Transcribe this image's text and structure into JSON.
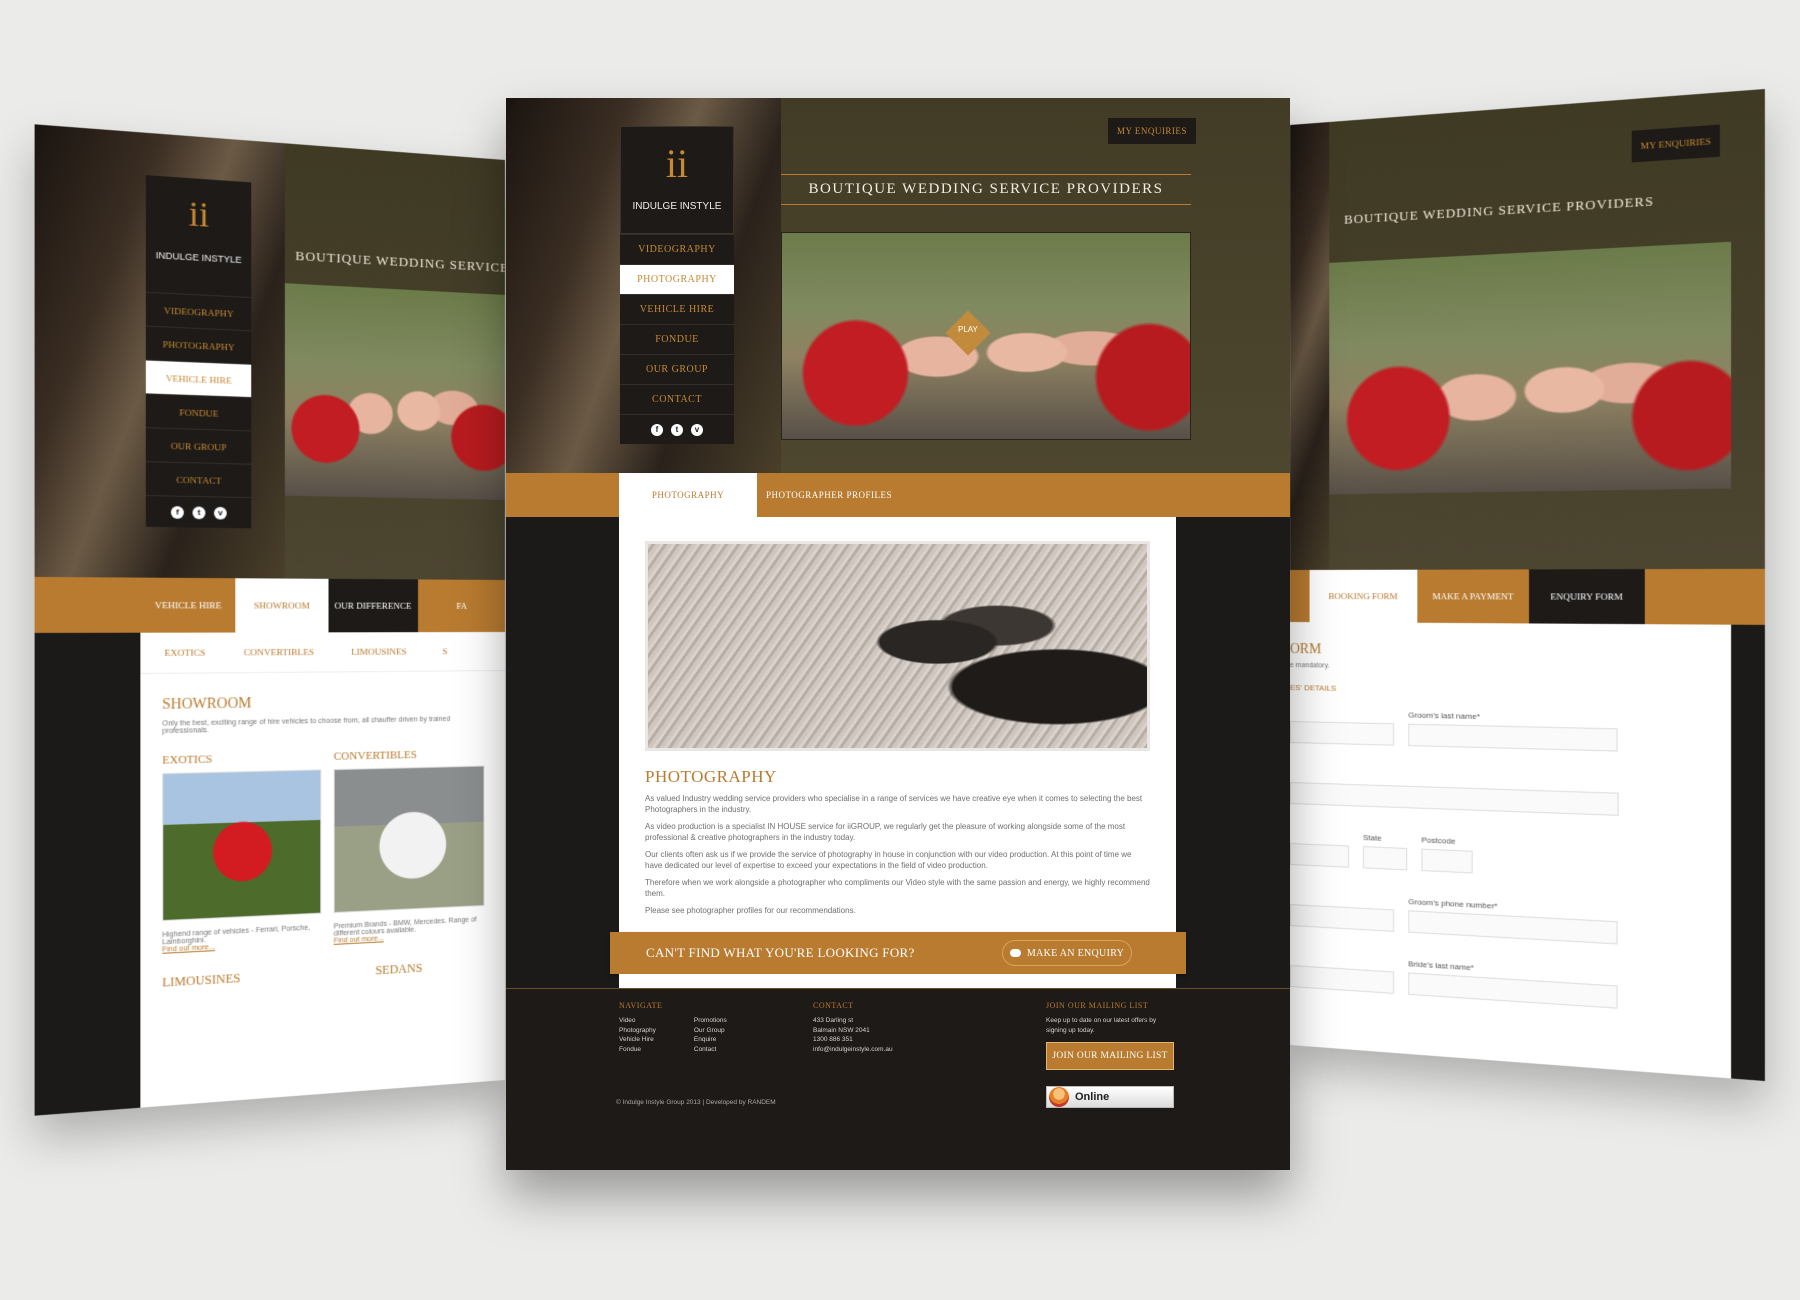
{
  "brand": {
    "name": "INDULGE INSTYLE"
  },
  "nav": [
    "VIDEOGRAPHY",
    "PHOTOGRAPHY",
    "VEHICLE HIRE",
    "FONDUE",
    "OUR GROUP",
    "CONTACT"
  ],
  "social": [
    "f",
    "t",
    "v"
  ],
  "header": {
    "headline": "BOUTIQUE WEDDING SERVICE PROVIDERS",
    "my_enquiries": "MY ENQUIRIES",
    "play": "PLAY"
  },
  "left": {
    "headline": "BOUTIQUE WEDDING SERVICE PROVI",
    "tabs": [
      "VEHICLE HIRE",
      "SHOWROOM",
      "OUR DIFFERENCE",
      "FA"
    ],
    "subtabs": [
      "EXOTICS",
      "CONVERTIBLES",
      "LIMOUSINES",
      "S"
    ],
    "heading": "SHOWROOM",
    "intro": "Only the best, exciting range of hire vehicles to choose from, all chauffer driven by trained professionals.",
    "cards": [
      {
        "title": "EXOTICS",
        "text": "Highend range of vehicles - Ferrari, Porsche, Lamborghini.",
        "link": "Find out more..."
      },
      {
        "title": "CONVERTIBLES",
        "text": "Premium Brands - BMW, Mercedes. Range of different colours available.",
        "link": "Find out more..."
      }
    ],
    "heading_limousines": "LIMOUSINES",
    "heading_sedans": "SEDANS"
  },
  "right": {
    "headline": "BOUTIQUE WEDDING SERVICE PROVIDERS",
    "tabs": [
      "BOOKING FORM",
      "MAKE A PAYMENT",
      "ENQUIRY FORM"
    ],
    "heading": "ORM",
    "note": "e mandatory.",
    "section": "ES' DETAILS",
    "fields": {
      "groom_last": "Groom's last name*",
      "state": "State",
      "postcode": "Postcode",
      "groom_phone": "Groom's phone number*",
      "bride_last": "Bride's last name*"
    }
  },
  "center": {
    "tabs": [
      "PHOTOGRAPHY",
      "PHOTOGRAPHER PROFILES"
    ],
    "heading": "PHOTOGRAPHY",
    "paragraphs": [
      "As valued Industry wedding service providers who specialise in a range of services we have creative eye when it comes to selecting the best Photographers in the industry.",
      "As video production is a specialist IN HOUSE service for iiGROUP, we regularly get the pleasure of working alongside some of the most professional & creative photographers in the industry today.",
      "Our clients often ask us if we provide the service of photography in house in conjunction with our video production. At this point of time we have dedicated our level of expertise to exceed your expectations in the field of video production.",
      "Therefore when we work alongside a photographer who compliments our Video style with the same passion and energy, we highly recommend them.",
      "Please see photographer profiles for our recommendations."
    ],
    "cta": {
      "question": "CAN'T FIND WHAT YOU'RE LOOKING FOR?",
      "button": "MAKE AN ENQUIRY"
    }
  },
  "footer": {
    "navigate_title": "NAVIGATE",
    "navigate_col1": [
      "Video",
      "Photography",
      "Vehicle Hire",
      "Fondue"
    ],
    "navigate_col2": [
      "Promotions",
      "Our Group",
      "Enquire",
      "Contact"
    ],
    "contact_title": "CONTACT",
    "contact": [
      "433 Darling st",
      "Balmain NSW 2041",
      "1300 886 351",
      "info@indulgeinstyle.com.au"
    ],
    "mailing_title": "JOIN OUR MAILING LIST",
    "mailing_text": "Keep up to date on our latest offers by signing up today.",
    "mailing_button": "JOIN OUR MAILING LIST",
    "online": "Online",
    "copyright": "© Indulge Instyle Group 2013  |  Developed by RANDEM"
  },
  "colors": {
    "accent": "#b87b30",
    "dark": "#1d1a17",
    "olive": "#4a4430"
  }
}
